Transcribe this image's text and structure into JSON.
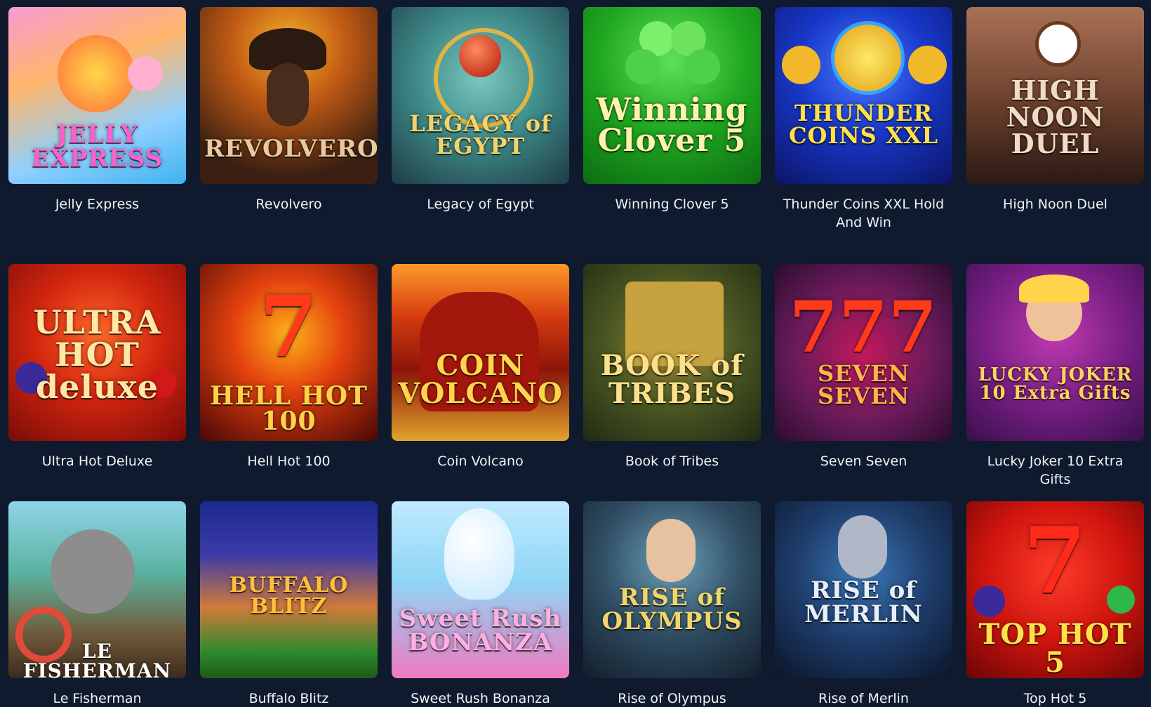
{
  "games": [
    {
      "name": "Jelly Express",
      "art_text": "JELLY EXPRESS",
      "art_color": "#ff5ecf",
      "icon": "train-icon"
    },
    {
      "name": "Revolvero",
      "art_text": "REVOLVERO",
      "art_color": "#e8c9a0",
      "icon": "cowboy-icon"
    },
    {
      "name": "Legacy of Egypt",
      "art_text": "LEGACY of EGYPT",
      "art_color": "#f4d36a",
      "icon": "scarab-icon"
    },
    {
      "name": "Winning Clover 5",
      "art_text": "Winning Clover 5",
      "art_color": "#fff2b0",
      "icon": "clover-icon"
    },
    {
      "name": "Thunder Coins XXL Hold And Win",
      "art_text": "THUNDER COINS XXL",
      "art_color": "#ffe14a",
      "icon": "lightning-icon"
    },
    {
      "name": "High Noon Duel",
      "art_text": "HIGH NOON DUEL",
      "art_color": "#f0dcc2",
      "icon": "clock-icon"
    },
    {
      "name": "Ultra Hot Deluxe",
      "art_text": "ULTRA HOT deluxe",
      "art_color": "#ffe7a6",
      "icon": "seven-icon"
    },
    {
      "name": "Hell Hot 100",
      "art_text": "HELL HOT 100",
      "art_color": "#ffd24a",
      "icon": "seven-icon"
    },
    {
      "name": "Coin Volcano",
      "art_text": "COIN VOLCANO",
      "art_color": "#ffd54a",
      "icon": "volcano-icon"
    },
    {
      "name": "Book of Tribes",
      "art_text": "BOOK of TRIBES",
      "art_color": "#ffe08a",
      "icon": "book-icon"
    },
    {
      "name": "Seven Seven",
      "art_text": "SEVEN SEVEN",
      "art_color": "#ffb34a",
      "icon": "seven-icon"
    },
    {
      "name": "Lucky Joker 10 Extra Gifts",
      "art_text": "LUCKY JOKER 10 Extra Gifts",
      "art_color": "#ffd35a",
      "icon": "joker-icon"
    },
    {
      "name": "Le Fisherman",
      "art_text": "LE FISHERMAN",
      "art_color": "#ffffff",
      "icon": "raccoon-icon"
    },
    {
      "name": "Buffalo Blitz",
      "art_text": "BUFFALO BLITZ",
      "art_color": "#ffbf3a",
      "icon": "buffalo-icon"
    },
    {
      "name": "Sweet Rush Bonanza",
      "art_text": "Sweet Rush BONANZA",
      "art_color": "#ffb0e0",
      "icon": "gumball-icon"
    },
    {
      "name": "Rise of Olympus",
      "art_text": "RISE of OLYMPUS",
      "art_color": "#f2d46a",
      "icon": "zeus-icon"
    },
    {
      "name": "Rise of Merlin",
      "art_text": "RISE of MERLIN",
      "art_color": "#e6eefc",
      "icon": "wizard-icon"
    },
    {
      "name": "Top Hot 5",
      "art_text": "TOP HOT 5",
      "art_color": "#ffe14a",
      "icon": "seven-icon"
    }
  ]
}
